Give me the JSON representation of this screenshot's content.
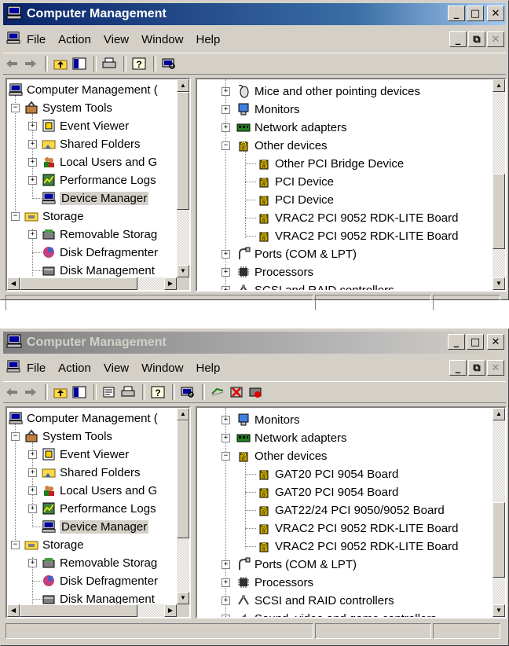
{
  "menus": [
    "File",
    "Action",
    "View",
    "Window",
    "Help"
  ],
  "window1": {
    "title": "Computer Management",
    "tree": {
      "root": "Computer Management (",
      "system_tools": "System Tools",
      "event_viewer": "Event Viewer",
      "shared_folders": "Shared Folders",
      "local_users": "Local Users and G",
      "performance_logs": "Performance Logs",
      "device_manager": "Device Manager",
      "storage": "Storage",
      "removable_storage": "Removable Storag",
      "disk_defragmenter": "Disk Defragmenter",
      "disk_management": "Disk Management"
    },
    "devices": {
      "mice": "Mice and other pointing devices",
      "monitors": "Monitors",
      "network_adapters": "Network adapters",
      "other_devices": "Other devices",
      "other_items": [
        "Other PCI Bridge Device",
        "PCI Device",
        "PCI Device",
        "VRAC2 PCI 9052 RDK-LITE Board",
        "VRAC2 PCI 9052 RDK-LITE Board"
      ],
      "ports": "Ports (COM & LPT)",
      "processors": "Processors",
      "scsi": "SCSI and RAID controllers"
    }
  },
  "window2": {
    "title": "Computer Management",
    "tree": {
      "root": "Computer Management (",
      "system_tools": "System Tools",
      "event_viewer": "Event Viewer",
      "shared_folders": "Shared Folders",
      "local_users": "Local Users and G",
      "performance_logs": "Performance Logs",
      "device_manager": "Device Manager",
      "storage": "Storage",
      "removable_storage": "Removable Storag",
      "disk_defragmenter": "Disk Defragmenter",
      "disk_management": "Disk Management"
    },
    "devices": {
      "monitors": "Monitors",
      "network_adapters": "Network adapters",
      "other_devices": "Other devices",
      "other_items": [
        "GAT20 PCI 9054 Board",
        "GAT20 PCI 9054 Board",
        "GAT22/24 PCI 9050/9052 Board",
        "VRAC2 PCI 9052 RDK-LITE Board",
        "VRAC2 PCI 9052 RDK-LITE Board"
      ],
      "ports": "Ports (COM & LPT)",
      "processors": "Processors",
      "scsi": "SCSI and RAID controllers",
      "sound": "Sound, video and game controllers"
    }
  },
  "colors": {
    "title_active": "#0a246a",
    "title_inactive": "#808080",
    "face": "#d4d0c8",
    "selection": "#d4d0c8"
  },
  "icons": {
    "computer": "computer-icon",
    "tools": "toolbox-icon",
    "event": "event-viewer-icon",
    "folder": "shared-folder-icon",
    "users": "users-icon",
    "perf": "performance-icon",
    "device": "device-manager-icon",
    "storage": "storage-icon",
    "unknown": "unknown-device-icon"
  }
}
